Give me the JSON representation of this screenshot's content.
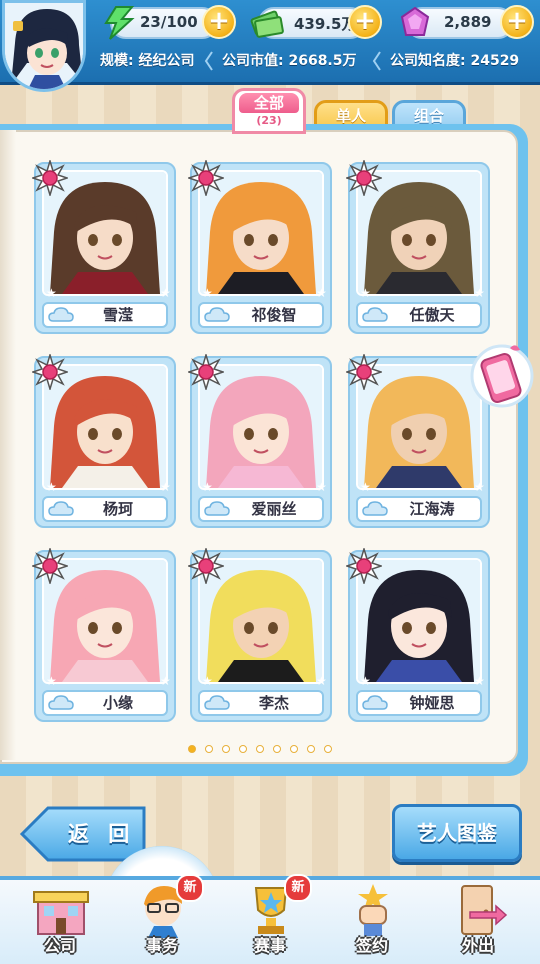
{
  "resources": {
    "energy": "23/100",
    "money": "439.5万",
    "gems": "2,889"
  },
  "company": {
    "scale": "规模: 经纪公司",
    "market_value": "公司市值: 2668.5万",
    "fame": "公司知名度: 24529"
  },
  "tabs": {
    "all_label": "全部",
    "all_count": "(23)",
    "single_label": "单人",
    "group_label": "组合"
  },
  "artists": [
    {
      "name": "雪滢",
      "hair": "#5a3b2a",
      "skin": "#f6dcc8",
      "cloth": "#8a1f2a"
    },
    {
      "name": "祁俊智",
      "hair": "#f09a3c",
      "skin": "#f6dcc8",
      "cloth": "#1d1d24"
    },
    {
      "name": "任傲天",
      "hair": "#6b5a3c",
      "skin": "#f0d2b8",
      "cloth": "#2a2a30"
    },
    {
      "name": "杨珂",
      "hair": "#d3553a",
      "skin": "#f8e0cc",
      "cloth": "#f4f0e8"
    },
    {
      "name": "爱丽丝",
      "hair": "#f3a6bc",
      "skin": "#fbe4d6",
      "cloth": "#f6b8d4"
    },
    {
      "name": "江海涛",
      "hair": "#f2b85a",
      "skin": "#f0cfb0",
      "cloth": "#2f3a6a"
    },
    {
      "name": "小缘",
      "hair": "#f7a7b4",
      "skin": "#fbe6da",
      "cloth": "#f7c9d3"
    },
    {
      "name": "李杰",
      "hair": "#f1dd5c",
      "skin": "#f3d2b4",
      "cloth": "#1c1c1c"
    },
    {
      "name": "钟娅思",
      "hair": "#1f1f2e",
      "skin": "#fbe7dc",
      "cloth": "#3a4ea8"
    }
  ],
  "pager": {
    "total": 9,
    "current": 1
  },
  "buttons": {
    "back": "返 回",
    "artist_dex": "艺人图鉴"
  },
  "nav": [
    {
      "label": "公司",
      "new": false
    },
    {
      "label": "事务",
      "new": true
    },
    {
      "label": "赛事",
      "new": true
    },
    {
      "label": "签约",
      "new": false
    },
    {
      "label": "外出",
      "new": false
    }
  ],
  "new_badge_text": "新"
}
